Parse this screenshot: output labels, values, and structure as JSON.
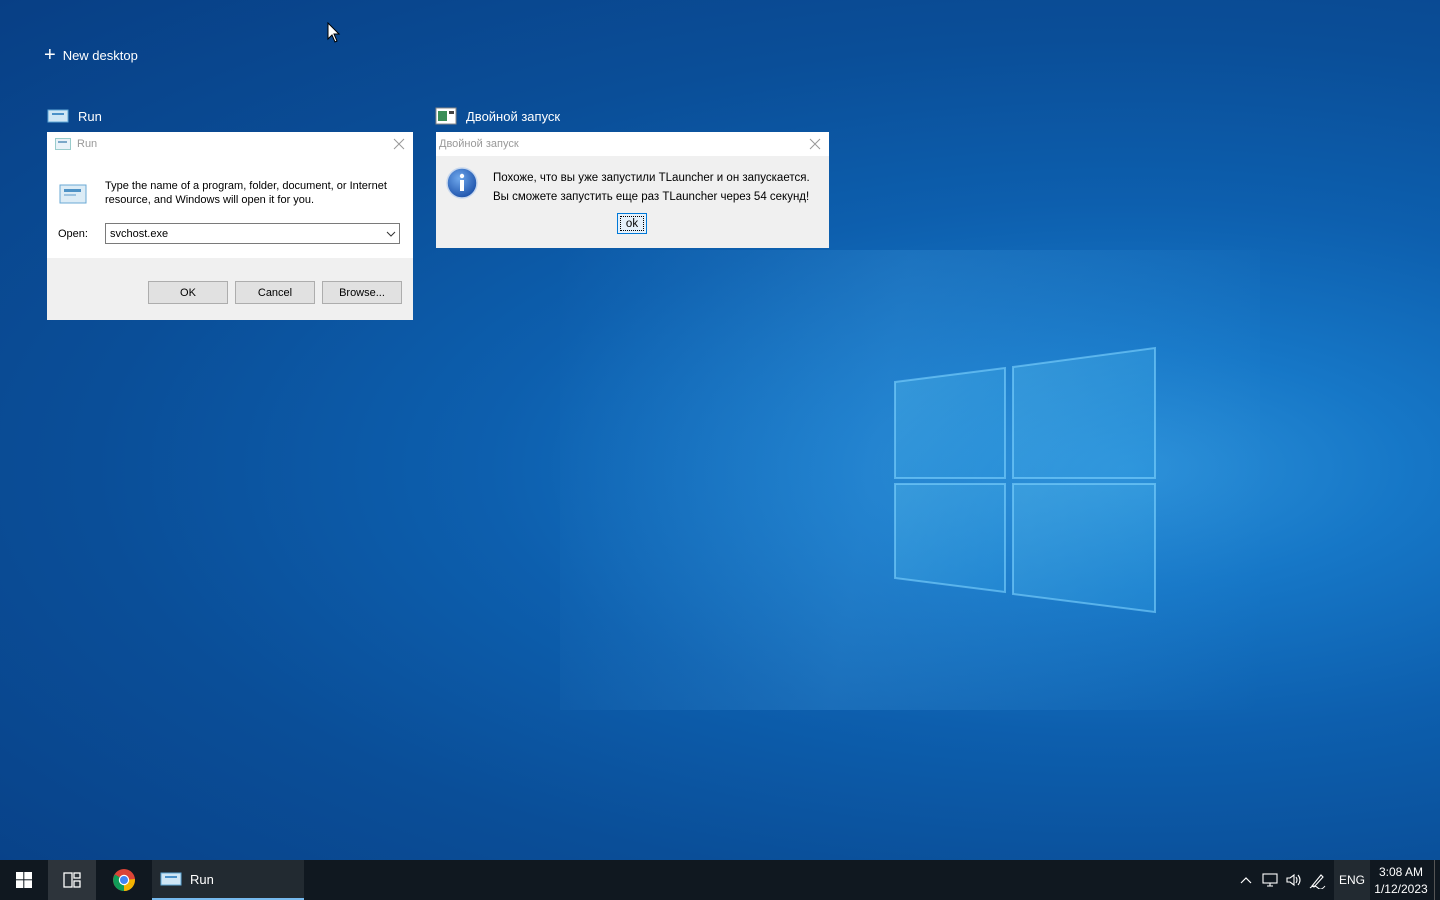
{
  "desktop": {
    "new_desktop_label": "New desktop"
  },
  "windows": {
    "run": {
      "thumb_label": "Run",
      "title": "Run",
      "description": "Type the name of a program, folder, document, or Internet resource, and Windows will open it for you.",
      "open_label": "Open:",
      "open_value": "svchost.exe",
      "ok_label": "OK",
      "cancel_label": "Cancel",
      "browse_label": "Browse..."
    },
    "double_launch": {
      "thumb_label": "Двойной запуск",
      "title": "Двойной запуск",
      "message_line1": "Похоже, что вы уже запустили TLauncher и он запускается.",
      "message_line2": "Вы сможете запустить еще раз TLauncher через 54 секунд!",
      "ok_label": "ok"
    }
  },
  "taskbar": {
    "items": [
      {
        "name": "start",
        "icon": "windows-icon"
      },
      {
        "name": "task-view",
        "icon": "task-view-icon"
      },
      {
        "name": "chrome",
        "icon": "chrome-icon"
      },
      {
        "name": "run",
        "icon": "run-icon",
        "label": "Run"
      }
    ],
    "run_label": "Run",
    "tray": {
      "language": "ENG",
      "time": "3:08 AM",
      "date": "1/12/2023"
    }
  },
  "colors": {
    "desktop_blue": "#0d5fae",
    "taskbar": "#101820",
    "accent": "#0078d7"
  }
}
